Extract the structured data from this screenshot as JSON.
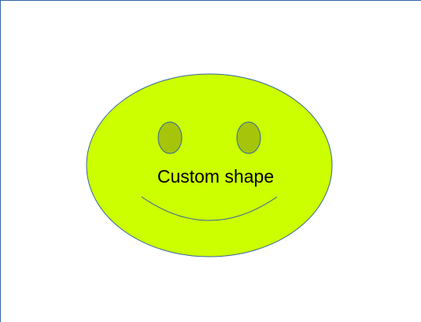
{
  "slide": {
    "shape_label": "Custom shape"
  },
  "colors": {
    "face_fill": "#ccff00",
    "face_stroke": "#3465a4",
    "eye_fill": "#a5c40a",
    "eye_stroke": "#3465a4",
    "mouth_stroke": "#3465a4",
    "label_color": "#000000",
    "page_edge": "#3465a4",
    "background": "#ffffff"
  },
  "icons": {
    "shape": "smiley-face-shape"
  }
}
